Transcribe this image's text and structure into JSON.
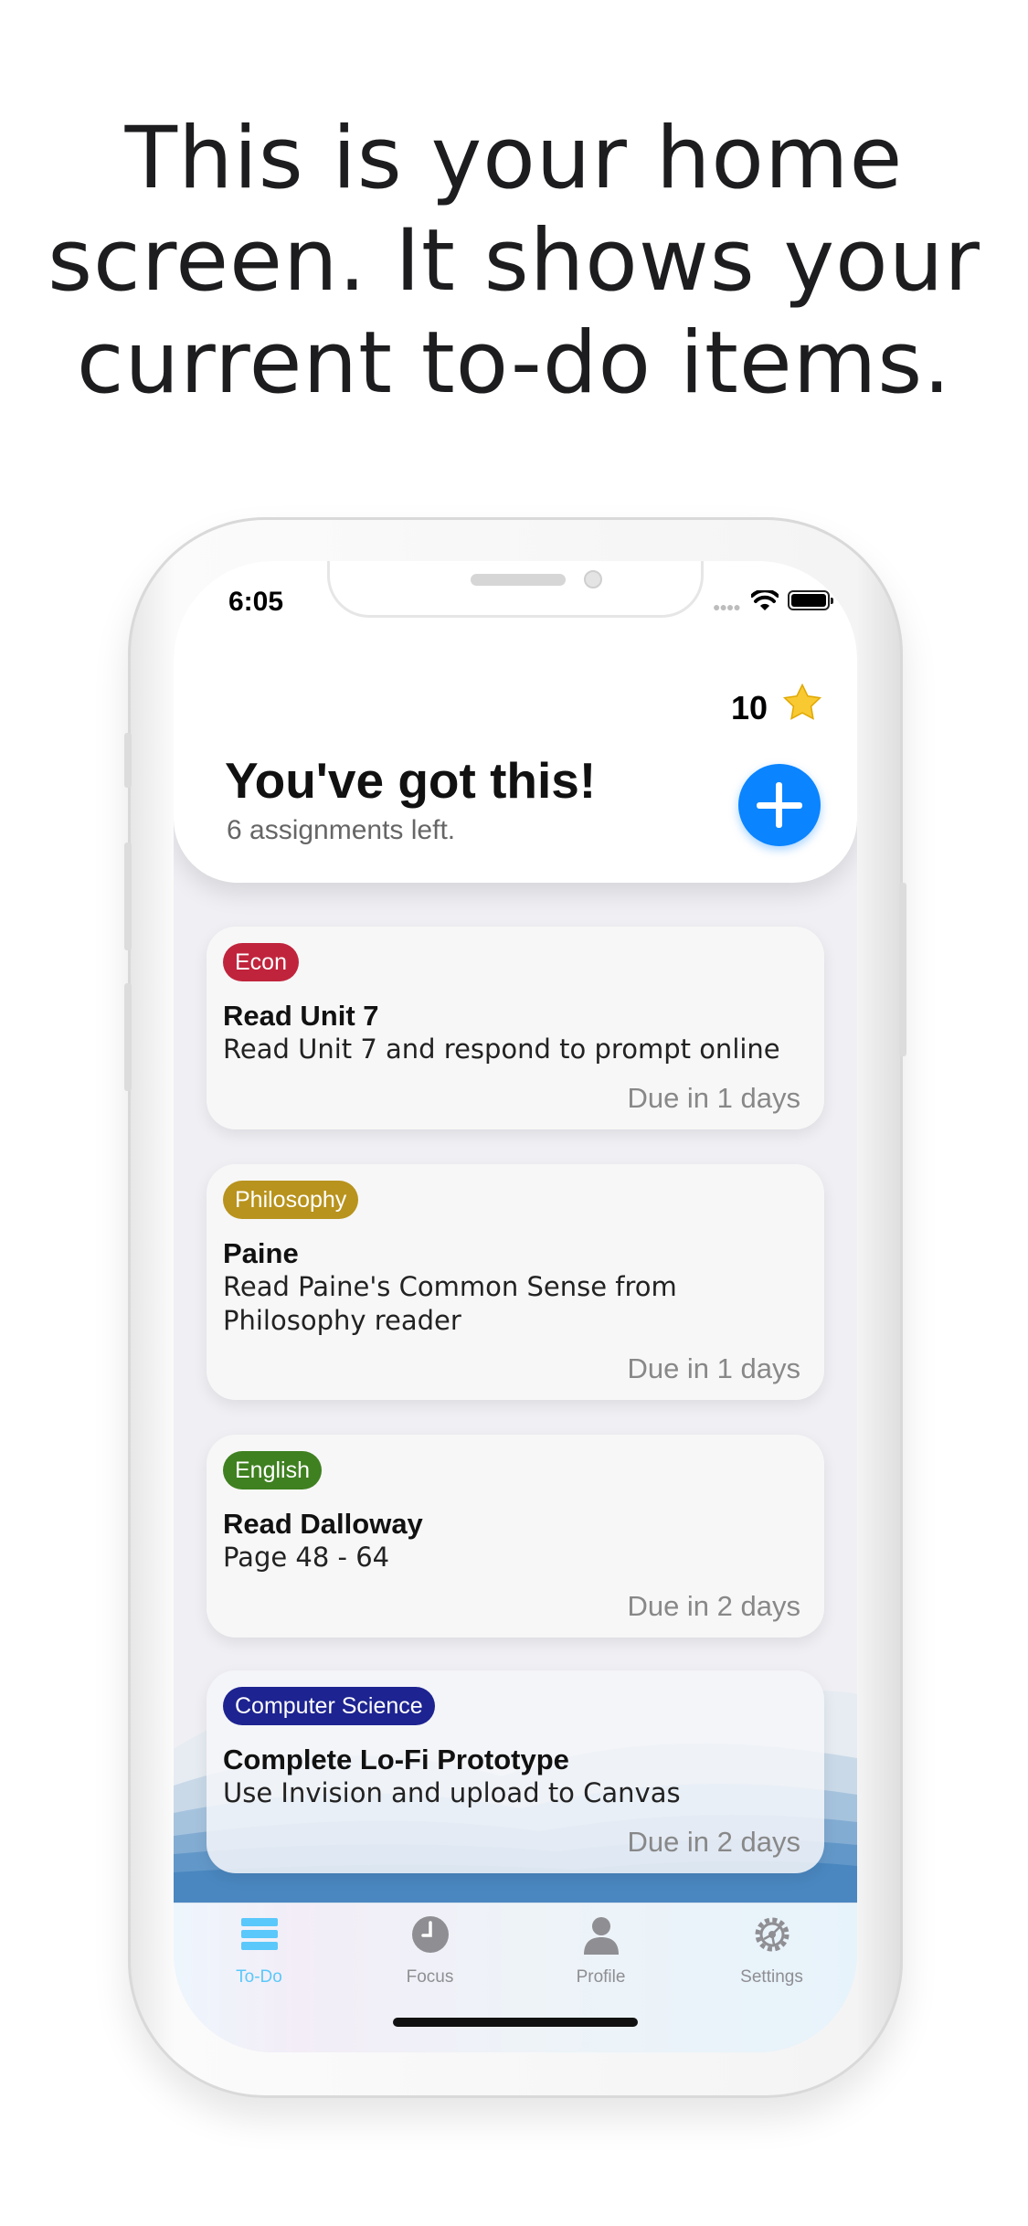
{
  "headline": {
    "line1": "This is your home",
    "line2": "screen. It shows your",
    "line3": "current to-do items."
  },
  "status_bar": {
    "time": "6:05"
  },
  "header": {
    "points": "10",
    "title": "You've got this!",
    "subtitle": "6 assignments left."
  },
  "cards": [
    {
      "tag": "Econ",
      "tag_color": "#c0243c",
      "title": "Read Unit 7",
      "desc_line1": "Read Unit 7 and respond to prompt online",
      "desc_line2": "",
      "due": "Due in 1 days"
    },
    {
      "tag": "Philosophy",
      "tag_color": "#b8931d",
      "title": "Paine",
      "desc_line1": "Read Paine's Common Sense from",
      "desc_line2": "Philosophy reader",
      "due": "Due in 1 days"
    },
    {
      "tag": "English",
      "tag_color": "#3f8020",
      "title": "Read Dalloway",
      "desc_line1": "Page 48 - 64",
      "desc_line2": "",
      "due": "Due in 2 days"
    },
    {
      "tag": "Computer Science",
      "tag_color": "#1d2390",
      "title": "Complete Lo-Fi Prototype",
      "desc_line1": "Use Invision and upload to Canvas",
      "desc_line2": "",
      "due": "Due in 2 days"
    }
  ],
  "tabs": [
    {
      "label": "To-Do",
      "icon": "list-icon",
      "active": true
    },
    {
      "label": "Focus",
      "icon": "clock-icon",
      "active": false
    },
    {
      "label": "Profile",
      "icon": "person-icon",
      "active": false
    },
    {
      "label": "Settings",
      "icon": "gear-icon",
      "active": false
    }
  ],
  "colors": {
    "accent": "#0a84ff",
    "active_tab": "#5ac8fa",
    "inactive_tab": "#8e8e93"
  }
}
